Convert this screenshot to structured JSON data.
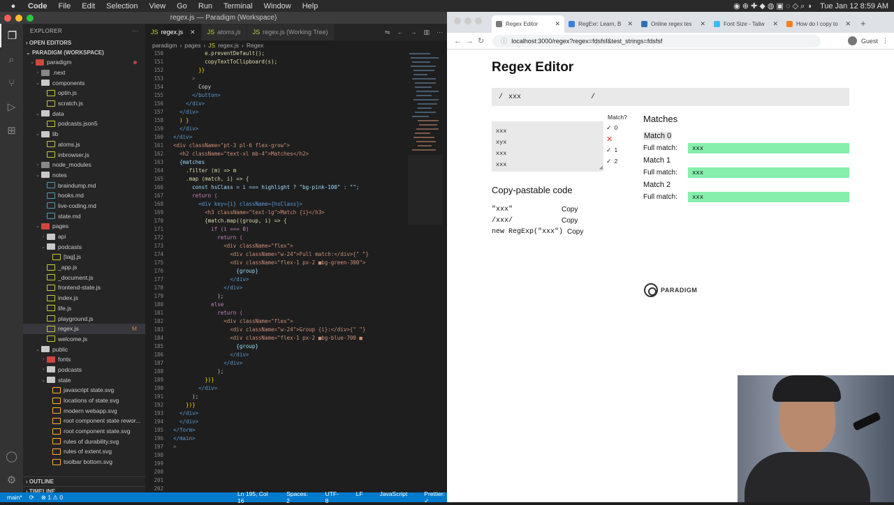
{
  "menubar": {
    "app": "Code",
    "items": [
      "File",
      "Edit",
      "Selection",
      "View",
      "Go",
      "Run",
      "Terminal",
      "Window",
      "Help"
    ],
    "clock": "Tue Jan 12  8:59 AM"
  },
  "vscode": {
    "title": "regex.js — Paradigm (Workspace)",
    "explorer": {
      "title": "EXPLORER",
      "open_editors": "OPEN EDITORS",
      "workspace": "PARADIGM (WORKSPACE)",
      "outline": "OUTLINE",
      "timeline": "TIMELINE",
      "tree": [
        {
          "label": "paradigm",
          "indent": 1,
          "type": "folder-open",
          "color": "#d0463d",
          "dot": true
        },
        {
          "label": ".next",
          "indent": 2,
          "type": "folder",
          "color": "#888"
        },
        {
          "label": "components",
          "indent": 2,
          "type": "folder-open",
          "color": "#c9c9c9"
        },
        {
          "label": "optin.js",
          "indent": 3,
          "type": "js",
          "color": "#cbcb41"
        },
        {
          "label": "scratch.js",
          "indent": 3,
          "type": "js",
          "color": "#cbcb41"
        },
        {
          "label": "data",
          "indent": 2,
          "type": "folder-open",
          "color": "#c9c9c9"
        },
        {
          "label": "podcasts.json5",
          "indent": 3,
          "type": "json",
          "color": "#cbcb41"
        },
        {
          "label": "lib",
          "indent": 2,
          "type": "folder-open",
          "color": "#c9c9c9"
        },
        {
          "label": "atoms.js",
          "indent": 3,
          "type": "js",
          "color": "#cbcb41"
        },
        {
          "label": "inbrowser.js",
          "indent": 3,
          "type": "js",
          "color": "#cbcb41"
        },
        {
          "label": "node_modules",
          "indent": 2,
          "type": "folder",
          "color": "#888"
        },
        {
          "label": "notes",
          "indent": 2,
          "type": "folder-open",
          "color": "#c9c9c9"
        },
        {
          "label": "braindump.md",
          "indent": 3,
          "type": "md",
          "color": "#519aba"
        },
        {
          "label": "hooks.md",
          "indent": 3,
          "type": "md",
          "color": "#519aba"
        },
        {
          "label": "live-coding.md",
          "indent": 3,
          "type": "md",
          "color": "#519aba"
        },
        {
          "label": "state.md",
          "indent": 3,
          "type": "md",
          "color": "#519aba"
        },
        {
          "label": "pages",
          "indent": 2,
          "type": "folder-open",
          "color": "#d0463d"
        },
        {
          "label": "api",
          "indent": 3,
          "type": "folder",
          "color": "#c9c9c9"
        },
        {
          "label": "podcasts",
          "indent": 3,
          "type": "folder-open",
          "color": "#c9c9c9"
        },
        {
          "label": "[tag].js",
          "indent": 4,
          "type": "js",
          "color": "#cbcb41"
        },
        {
          "label": "_app.js",
          "indent": 3,
          "type": "js",
          "color": "#cbcb41"
        },
        {
          "label": "_document.js",
          "indent": 3,
          "type": "js",
          "color": "#cbcb41"
        },
        {
          "label": "frontend-state.js",
          "indent": 3,
          "type": "js",
          "color": "#cbcb41"
        },
        {
          "label": "index.js",
          "indent": 3,
          "type": "js",
          "color": "#cbcb41"
        },
        {
          "label": "life.js",
          "indent": 3,
          "type": "js",
          "color": "#cbcb41"
        },
        {
          "label": "playground.js",
          "indent": 3,
          "type": "js",
          "color": "#cbcb41"
        },
        {
          "label": "regex.js",
          "indent": 3,
          "type": "js",
          "color": "#cbcb41",
          "active": true,
          "mod": "M"
        },
        {
          "label": "welcome.js",
          "indent": 3,
          "type": "js",
          "color": "#cbcb41"
        },
        {
          "label": "public",
          "indent": 2,
          "type": "folder-open",
          "color": "#c9c9c9"
        },
        {
          "label": "fonts",
          "indent": 3,
          "type": "folder",
          "color": "#d0463d"
        },
        {
          "label": "podcasts",
          "indent": 3,
          "type": "folder",
          "color": "#c9c9c9"
        },
        {
          "label": "state",
          "indent": 3,
          "type": "folder-open",
          "color": "#c9c9c9"
        },
        {
          "label": "javascript state.svg",
          "indent": 4,
          "type": "svg",
          "color": "#ffb13b"
        },
        {
          "label": "locations of state.svg",
          "indent": 4,
          "type": "svg",
          "color": "#ffb13b"
        },
        {
          "label": "modern webapp.svg",
          "indent": 4,
          "type": "svg",
          "color": "#ffb13b"
        },
        {
          "label": "root component state rewor...",
          "indent": 4,
          "type": "svg",
          "color": "#ffb13b"
        },
        {
          "label": "root component state.svg",
          "indent": 4,
          "type": "svg",
          "color": "#ffb13b"
        },
        {
          "label": "rules of durability.svg",
          "indent": 4,
          "type": "svg",
          "color": "#ffb13b"
        },
        {
          "label": "rules of extent.svg",
          "indent": 4,
          "type": "svg",
          "color": "#ffb13b"
        },
        {
          "label": "toolbar bottom.svg",
          "indent": 4,
          "type": "svg",
          "color": "#ffb13b"
        }
      ]
    },
    "tabs": [
      {
        "label": "regex.js",
        "active": true
      },
      {
        "label": "atoms.js",
        "italic": true
      },
      {
        "label": "regex.js (Working Tree)"
      }
    ],
    "breadcrumb": [
      "paradigm",
      "pages",
      "regex.js",
      "Regex"
    ],
    "code": [
      {
        "n": "150",
        "t": "          e.preventDefault();",
        "c": "#dcdcaa"
      },
      {
        "n": "151",
        "t": "          copyTextToClipboard(s);",
        "c": "#dcdcaa"
      },
      {
        "n": "152",
        "t": "        }}",
        "c": "#ffd700"
      },
      {
        "n": "153",
        "t": "      >",
        "c": "#808080"
      },
      {
        "n": "154",
        "t": "        Copy",
        "c": "#d4d4d4"
      },
      {
        "n": "155",
        "t": "      </button>",
        "c": "#569cd6"
      },
      {
        "n": "156",
        "t": "    </div>",
        "c": "#569cd6"
      },
      {
        "n": "157",
        "t": "  </div>",
        "c": "#569cd6"
      },
      {
        "n": "158",
        "t": "  ) }",
        "c": "#ffd700"
      },
      {
        "n": "159",
        "t": "  </div>",
        "c": "#569cd6"
      },
      {
        "n": "160",
        "t": "</div>",
        "c": "#569cd6"
      },
      {
        "n": "161",
        "t": "<div className=\"pt-3 pl-6 flex-grow\">",
        "c": "#ce9178"
      },
      {
        "n": "162",
        "t": "  <h2 className=\"text-xl mb-4\">Matches</h2>",
        "c": "#ce9178"
      },
      {
        "n": "163",
        "t": "  {matches",
        "c": "#9cdcfe"
      },
      {
        "n": "164",
        "t": "    .filter (m) => m",
        "c": "#dcdcaa"
      },
      {
        "n": "165",
        "t": "    .map (match, i) => {",
        "c": "#dcdcaa"
      },
      {
        "n": "166",
        "t": "      const hsClass = i === highlight ? \"bg-pink-100\" : \"\";",
        "c": "#9cdcfe"
      },
      {
        "n": "167",
        "t": "      return (",
        "c": "#c586c0"
      },
      {
        "n": "168",
        "t": "        <div key={i} className={hsClass}>",
        "c": "#569cd6"
      },
      {
        "n": "169",
        "t": "          <h3 className=\"text-lg\">Match {i}</h3>",
        "c": "#ce9178"
      },
      {
        "n": "170",
        "t": "          {match.map((group, i) => {",
        "c": "#dcdcaa"
      },
      {
        "n": "171",
        "t": "            if (i === 0)",
        "c": "#c586c0"
      },
      {
        "n": "172",
        "t": "              return (",
        "c": "#c586c0"
      },
      {
        "n": "173",
        "t": "                <div className=\"flex\">",
        "c": "#ce9178"
      },
      {
        "n": "174",
        "t": "                  <div className=\"w-24\">Full match:</div>{\" \"}",
        "c": "#ce9178"
      },
      {
        "n": "175",
        "t": "                  <div className=\"flex-1 px-2 ■bg-green-300\">",
        "c": "#ce9178"
      },
      {
        "n": "176",
        "t": "                    {group}",
        "c": "#9cdcfe"
      },
      {
        "n": "177",
        "t": "                  </div>",
        "c": "#569cd6"
      },
      {
        "n": "178",
        "t": "                </div>",
        "c": "#569cd6"
      },
      {
        "n": "179",
        "t": "              );",
        "c": "#d4d4d4"
      },
      {
        "n": "180",
        "t": "            else",
        "c": "#c586c0"
      },
      {
        "n": "181",
        "t": "              return (",
        "c": "#c586c0"
      },
      {
        "n": "182",
        "t": "                <div className=\"flex\">",
        "c": "#ce9178"
      },
      {
        "n": "183",
        "t": "                  <div className=\"w-24\">Group {i}:</div>{\" \"}",
        "c": "#ce9178"
      },
      {
        "n": "184",
        "t": "                  <div className=\"flex-1 px-2 ■bg-blue-700 ■",
        "c": "#ce9178"
      },
      {
        "n": "185",
        "t": "                    {group}",
        "c": "#9cdcfe"
      },
      {
        "n": "186",
        "t": "                  </div>",
        "c": "#569cd6"
      },
      {
        "n": "187",
        "t": "                </div>",
        "c": "#569cd6"
      },
      {
        "n": "188",
        "t": "              );",
        "c": "#d4d4d4"
      },
      {
        "n": "189",
        "t": "          })}",
        "c": "#ffd700"
      },
      {
        "n": "190",
        "t": "        </div>",
        "c": "#569cd6"
      },
      {
        "n": "191",
        "t": "      );",
        "c": "#d4d4d4"
      },
      {
        "n": "192",
        "t": "    })}",
        "c": "#ffd700"
      },
      {
        "n": "193",
        "t": "  </div>",
        "c": "#569cd6"
      },
      {
        "n": "194",
        "t": "  </div>",
        "c": "#569cd6"
      },
      {
        "n": "195",
        "t": "</form>",
        "c": "#569cd6"
      },
      {
        "n": "196",
        "t": "</main>",
        "c": "#569cd6"
      },
      {
        "n": "197",
        "t": ">",
        "c": "#808080"
      },
      {
        "n": "198",
        "t": "",
        "c": "#d4d4d4"
      },
      {
        "n": "199",
        "t": "",
        "c": "#d4d4d4"
      },
      {
        "n": "200",
        "t": "",
        "c": "#d4d4d4"
      },
      {
        "n": "201",
        "t": "",
        "c": "#d4d4d4"
      },
      {
        "n": "202",
        "t": "",
        "c": "#d4d4d4"
      }
    ],
    "status": {
      "branch": "main*",
      "errors": "⊗ 1 ⚠ 0",
      "position": "Ln 195, Col 16",
      "spaces": "Spaces: 2",
      "encoding": "UTF-8",
      "eol": "LF",
      "lang": "JavaScript",
      "prettier": "Prettier: ✓"
    }
  },
  "browser": {
    "tabs": [
      {
        "label": "Regex Editor",
        "active": true,
        "fav": "#7a7a7a"
      },
      {
        "label": "RegExr: Learn, B",
        "fav": "#3b7dd8"
      },
      {
        "label": "Online regex tes",
        "fav": "#2f6fb3"
      },
      {
        "label": "Font Size - Tailw",
        "fav": "#38bdf8"
      },
      {
        "label": "How do I copy to",
        "fav": "#f48024"
      }
    ],
    "url": "localhost:3000/regex?regex=fdsfsf&test_strings=fdsfsf",
    "guest": "Guest",
    "page": {
      "title": "Regex Editor",
      "regex": {
        "slash_open": "/",
        "value": "xxx",
        "slash_close": "/"
      },
      "tests": [
        "xxx",
        "xyx",
        "xxx",
        "xxx"
      ],
      "match_header": "Match?",
      "match_marks": [
        {
          "ok": true,
          "idx": "0"
        },
        {
          "ok": false,
          "idx": ""
        },
        {
          "ok": true,
          "idx": "1"
        },
        {
          "ok": true,
          "idx": "2"
        }
      ],
      "matches_header": "Matches",
      "matches": [
        {
          "title": "Match 0",
          "label": "Full match:",
          "value": "xxx",
          "selected": true
        },
        {
          "title": "Match 1",
          "label": "Full match:",
          "value": "xxx"
        },
        {
          "title": "Match 2",
          "label": "Full match:",
          "value": "xxx"
        }
      ],
      "copy_header": "Copy-pastable code",
      "copy_rows": [
        {
          "code": "\"xxx\"",
          "btn": "Copy"
        },
        {
          "code": "/xxx/",
          "btn": "Copy"
        },
        {
          "code": "new RegExp(\"xxx\")",
          "btn": "Copy"
        }
      ],
      "logo": "PARADIGM"
    }
  }
}
